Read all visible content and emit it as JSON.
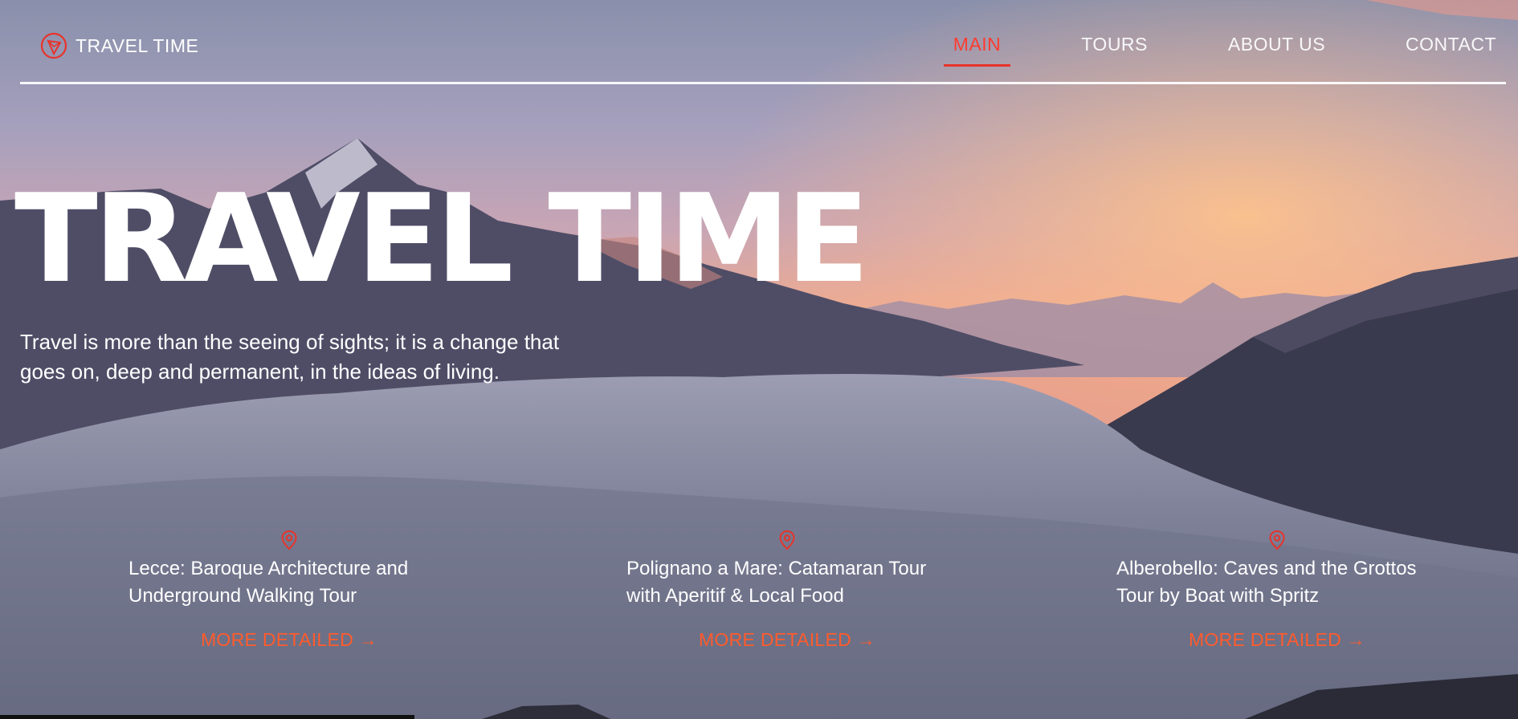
{
  "header": {
    "logo_text": "TRAVEL TIME",
    "logo_icon": "compass-icon",
    "nav": [
      {
        "label": "MAIN",
        "active": true
      },
      {
        "label": "TOURS",
        "active": false
      },
      {
        "label": "ABOUT US",
        "active": false
      },
      {
        "label": "CONTACT",
        "active": false
      }
    ]
  },
  "hero": {
    "title": "TRAVEL TIME",
    "tagline": "Travel is more than the seeing of sights; it is a change that goes on, deep and permanent, in the ideas of living."
  },
  "tours": [
    {
      "title": "Lecce: Baroque Architecture and Underground Walking Tour",
      "link": "MORE DETAILED →",
      "icon": "map-pin-icon"
    },
    {
      "title": "Polignano a Mare: Catamaran Tour with Aperitif & Local Food",
      "link": "MORE DETAILED →",
      "icon": "map-pin-icon"
    },
    {
      "title": "Alberobello: Caves and the Grottos Tour by Boat with Spritz",
      "link": "MORE DETAILED →",
      "icon": "map-pin-icon"
    }
  ],
  "colors": {
    "accent": "#e8332a",
    "link": "#ff5b2c",
    "text": "#ffffff"
  }
}
